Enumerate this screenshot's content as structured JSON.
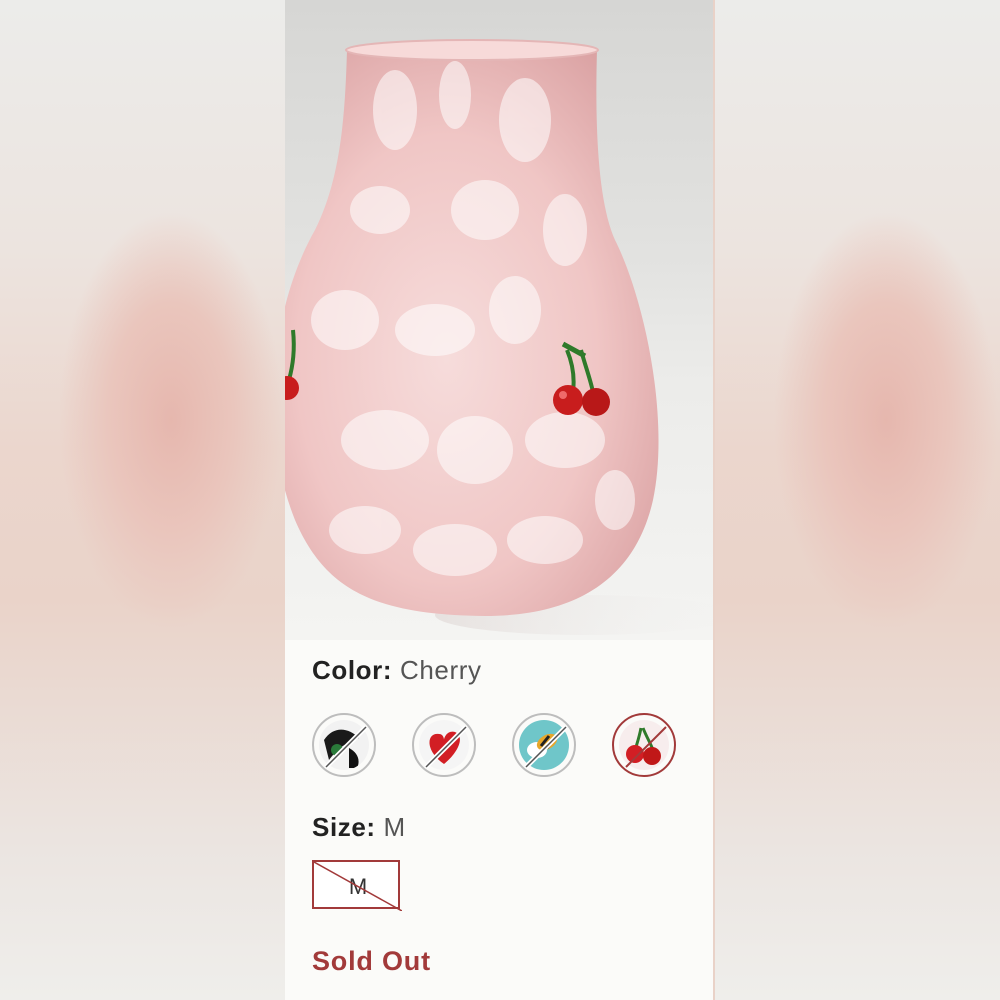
{
  "color": {
    "label": "Color:",
    "value": "Cherry",
    "swatches": [
      {
        "name": "black-white-swirl",
        "selected": false,
        "available": false
      },
      {
        "name": "red-heart",
        "selected": false,
        "available": false
      },
      {
        "name": "bee",
        "selected": false,
        "available": false
      },
      {
        "name": "cherry",
        "selected": true,
        "available": false
      }
    ]
  },
  "size": {
    "label": "Size:",
    "value": "M",
    "options": [
      "M"
    ]
  },
  "status": {
    "sold_out": "Sold Out"
  },
  "theme": {
    "accent": "#a23a3a",
    "vase_pink": "#f2c8c6",
    "background": "#fbfbf9"
  }
}
